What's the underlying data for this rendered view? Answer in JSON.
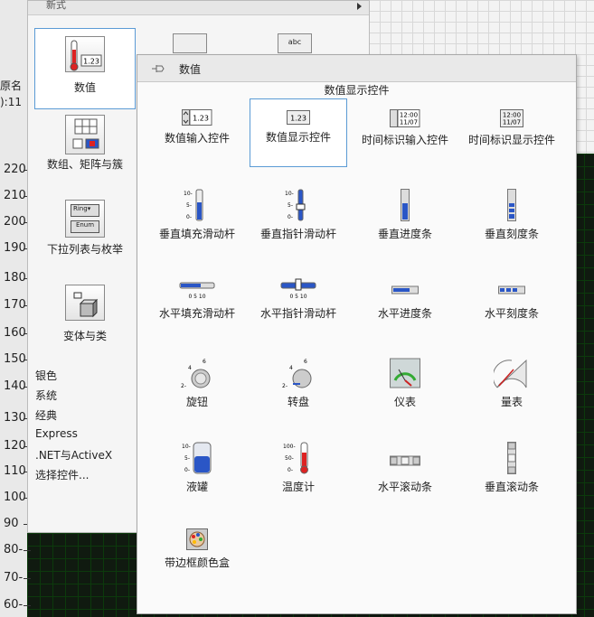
{
  "background": {
    "y_labels": [
      "220",
      "210",
      "200",
      "190",
      "180",
      "170",
      "160",
      "150",
      "140",
      "130",
      "120",
      "110",
      "100",
      "90",
      "80-",
      "70-",
      "60-"
    ],
    "partial_labels": [
      "原名",
      "):11"
    ]
  },
  "back_palette": {
    "top_text": "新式",
    "categories": [
      {
        "label": "数值"
      },
      {
        "label": "数组、矩阵与簇"
      },
      {
        "label": "下拉列表与枚举"
      },
      {
        "label": "变体与类"
      }
    ],
    "ring_text": "Ring",
    "enum_text": "Enum",
    "list": [
      "银色",
      "系统",
      "经典",
      "Express",
      ".NET与ActiveX",
      "选择控件..."
    ]
  },
  "submenu": {
    "title": "数值",
    "caption": "数值显示控件",
    "items": [
      {
        "label": "数值输入控件",
        "icon": "numeric-control-icon",
        "text": "1.23"
      },
      {
        "label": "数值显示控件",
        "icon": "numeric-indicator-icon",
        "text": "1.23"
      },
      {
        "label": "时间标识输入控件",
        "icon": "timestamp-control-icon",
        "text": "12:00 11/07"
      },
      {
        "label": "时间标识显示控件",
        "icon": "timestamp-indicator-icon",
        "text": "12:00 11/07"
      },
      {
        "label": "垂直填充滑动杆",
        "icon": "vertical-fill-slide-icon"
      },
      {
        "label": "垂直指针滑动杆",
        "icon": "vertical-pointer-slide-icon"
      },
      {
        "label": "垂直进度条",
        "icon": "vertical-progress-bar-icon"
      },
      {
        "label": "垂直刻度条",
        "icon": "vertical-graduated-bar-icon"
      },
      {
        "label": "水平填充滑动杆",
        "icon": "horizontal-fill-slide-icon"
      },
      {
        "label": "水平指针滑动杆",
        "icon": "horizontal-pointer-slide-icon"
      },
      {
        "label": "水平进度条",
        "icon": "horizontal-progress-bar-icon"
      },
      {
        "label": "水平刻度条",
        "icon": "horizontal-graduated-bar-icon"
      },
      {
        "label": "旋钮",
        "icon": "knob-icon"
      },
      {
        "label": "转盘",
        "icon": "dial-icon"
      },
      {
        "label": "仪表",
        "icon": "gauge-icon"
      },
      {
        "label": "量表",
        "icon": "meter-icon"
      },
      {
        "label": "液罐",
        "icon": "tank-icon"
      },
      {
        "label": "温度计",
        "icon": "thermometer-icon"
      },
      {
        "label": "水平滚动条",
        "icon": "horizontal-scrollbar-icon"
      },
      {
        "label": "垂直滚动条",
        "icon": "vertical-scrollbar-icon"
      },
      {
        "label": "带边框颜色盒",
        "icon": "framed-color-box-icon"
      }
    ],
    "scale": {
      "t10": "10-",
      "t5": "5-",
      "t0": "0-",
      "h": "0   5  10",
      "k2": "2-",
      "k4": "4",
      "k6": "6",
      "t100": "100-",
      "t50": "50-"
    }
  },
  "colors": {
    "accent": "#5b9bd5",
    "bar": "#2a56c6",
    "chart_bg": "#101a10"
  }
}
